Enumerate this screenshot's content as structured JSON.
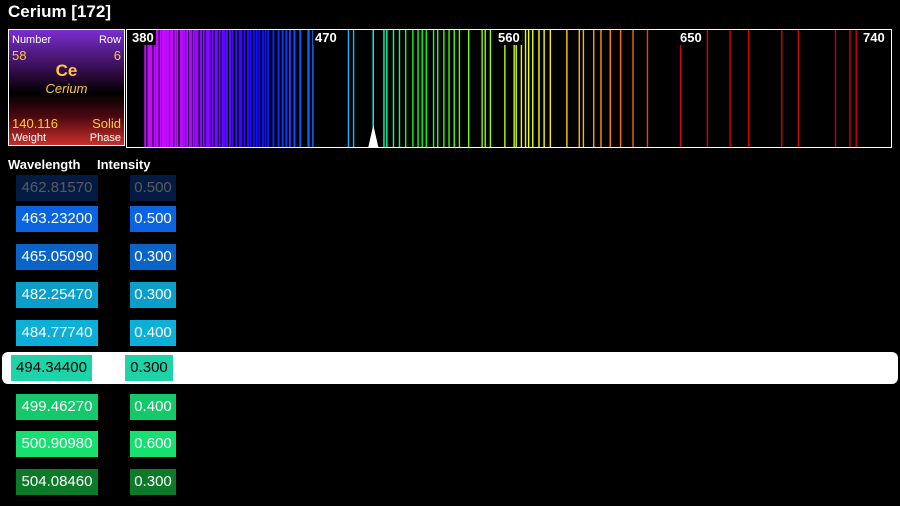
{
  "title": "Cerium [172]",
  "element": {
    "number_label": "Number",
    "row_label": "Row",
    "number": "58",
    "row": "6",
    "symbol": "Ce",
    "name": "Cerium",
    "weight": "140.116",
    "phase": "Solid",
    "weight_label": "Weight",
    "phase_label": "Phase"
  },
  "spectrum": {
    "ticks": [
      "380",
      "470",
      "560",
      "650",
      "740"
    ],
    "range_nm": [
      380,
      740
    ],
    "selected_nm": 494.344,
    "lines_nm": [
      384,
      385.5,
      386.3,
      387,
      388.5,
      389.6,
      390,
      391.5,
      392.5,
      393.1,
      394,
      395,
      396.2,
      397,
      398.5,
      399.5,
      401.2,
      402,
      403,
      404.2,
      405.5,
      406.3,
      407.5,
      408.5,
      409.3,
      411,
      412.3,
      413.8,
      414.5,
      415.2,
      416.6,
      418,
      418.7,
      420,
      421.5,
      422.3,
      423.5,
      425,
      426.2,
      428,
      429.7,
      430.5,
      432,
      433.7,
      435,
      436.5,
      438,
      439.2,
      441,
      442.2,
      443.5,
      446,
      448.5,
      450.5,
      452.3,
      454,
      456.2,
      459,
      462.8,
      463.2,
      465.1,
      482.3,
      484.8,
      494.3,
      499.5,
      500.9,
      504.1,
      507,
      510,
      513.5,
      516,
      518,
      520,
      523.5,
      525.5,
      528.5,
      531,
      533.5,
      536,
      540.5,
      547,
      548.5,
      551,
      558,
      562.5,
      563.5,
      566,
      568,
      569.5,
      571.5,
      574.5,
      577,
      580,
      588,
      594,
      596,
      601,
      604.5,
      609,
      614,
      620,
      627,
      643,
      656,
      667,
      676,
      692,
      700,
      718,
      725,
      728
    ]
  },
  "columns": {
    "wavelength": "Wavelength",
    "intensity": "Intensity"
  },
  "rows": [
    {
      "wavelength": "462.81570",
      "intensity": "0.500",
      "color": "#0a4fbf",
      "faded": true
    },
    {
      "wavelength": "463.23200",
      "intensity": "0.500",
      "color": "#0a64df"
    },
    {
      "wavelength": "465.05090",
      "intensity": "0.300",
      "color": "#0a64c8"
    },
    {
      "wavelength": "482.25470",
      "intensity": "0.300",
      "color": "#0a9fcb"
    },
    {
      "wavelength": "484.77740",
      "intensity": "0.400",
      "color": "#0ab0d8"
    },
    {
      "wavelength": "494.34400",
      "intensity": "0.300",
      "color": "#1dd3a7",
      "selected": true
    },
    {
      "wavelength": "499.46270",
      "intensity": "0.400",
      "color": "#15c86a"
    },
    {
      "wavelength": "500.90980",
      "intensity": "0.600",
      "color": "#18e070"
    },
    {
      "wavelength": "504.08460",
      "intensity": "0.300",
      "color": "#0d7a2a"
    }
  ]
}
